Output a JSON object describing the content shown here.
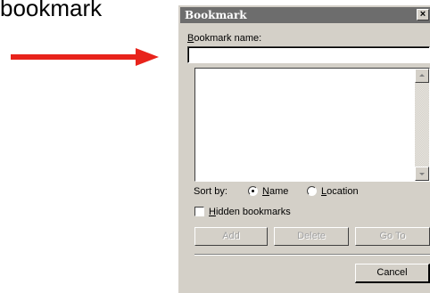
{
  "caption": "bookmark",
  "dialog": {
    "title": "Bookmark",
    "close_label": "×",
    "bookmark_name": {
      "label_mnemonic": "B",
      "label_rest": "ookmark name:",
      "value": ""
    },
    "bookmark_list": [],
    "sort_by": {
      "label": "Sort by:",
      "options": [
        {
          "mnemonic": "N",
          "rest": "ame",
          "selected": true
        },
        {
          "mnemonic": "L",
          "rest": "ocation",
          "selected": false
        }
      ]
    },
    "hidden_bookmarks": {
      "mnemonic": "H",
      "rest": "idden bookmarks",
      "checked": false
    },
    "buttons": {
      "add": "Add",
      "delete": "Delete",
      "goto": "Go To",
      "cancel": "Cancel"
    }
  },
  "colors": {
    "arrow": "#e8231b",
    "titlebar": "#6d6d6d",
    "dialog_face": "#d4d0c8"
  }
}
